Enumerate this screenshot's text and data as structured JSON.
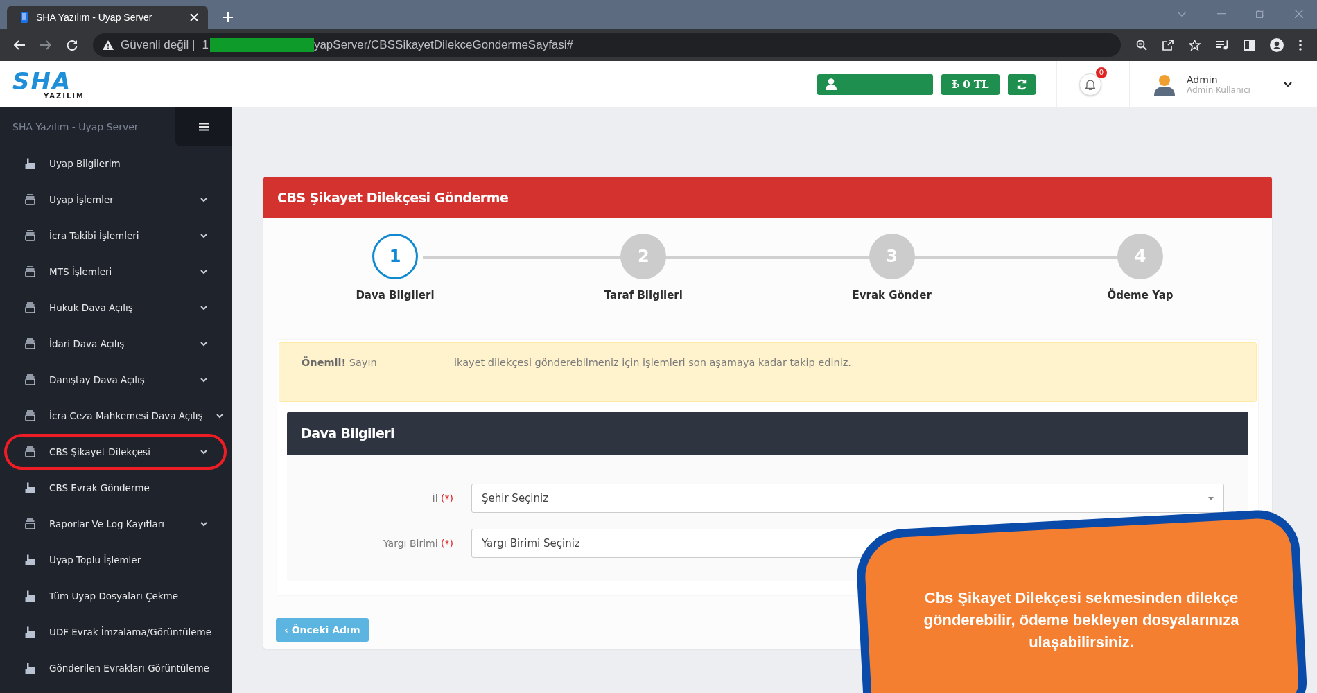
{
  "browser": {
    "tab_title": "SHA Yazılım - Uyap Server",
    "security": "Güvenli değil |",
    "url_start": "1",
    "url": "yapServer/CBSSikayetDilekceGondermeSayfasi#"
  },
  "header": {
    "logo": "SHA",
    "logo_sub": "YAZILIM",
    "balance": "₺ 0 TL",
    "notification_count": "0",
    "user_name": "Admin",
    "user_role": "Admin Kullanıcı"
  },
  "sidebar": {
    "title": "SHA Yazılım - Uyap Server",
    "items": [
      {
        "label": "Uyap Bilgilerim",
        "kind": "link",
        "selected": false
      },
      {
        "label": "Uyap İşlemler",
        "kind": "menu",
        "selected": false
      },
      {
        "label": "İcra Takibi İşlemleri",
        "kind": "menu",
        "selected": false
      },
      {
        "label": "MTS İşlemleri",
        "kind": "menu",
        "selected": false
      },
      {
        "label": "Hukuk Dava Açılış",
        "kind": "menu",
        "selected": false
      },
      {
        "label": "İdari Dava Açılış",
        "kind": "menu",
        "selected": false
      },
      {
        "label": "Danıştay Dava Açılış",
        "kind": "menu",
        "selected": false
      },
      {
        "label": "İcra Ceza Mahkemesi Dava Açılış",
        "kind": "menu",
        "selected": false
      },
      {
        "label": "CBS Şikayet Dilekçesi",
        "kind": "menu",
        "selected": true
      },
      {
        "label": "CBS Evrak Gönderme",
        "kind": "link",
        "selected": false
      },
      {
        "label": "Raporlar Ve Log Kayıtları",
        "kind": "menu",
        "selected": false
      },
      {
        "label": "Uyap Toplu İşlemler",
        "kind": "link",
        "selected": false
      },
      {
        "label": "Tüm Uyap Dosyaları Çekme",
        "kind": "link",
        "selected": false
      },
      {
        "label": "UDF Evrak İmzalama/Görüntüleme",
        "kind": "link",
        "selected": false
      },
      {
        "label": "Gönderilen Evrakları Görüntüleme",
        "kind": "link",
        "selected": false
      }
    ]
  },
  "card": {
    "title": "CBS Şikayet Dilekçesi Gönderme",
    "steps": [
      {
        "number": "1",
        "label": "Dava Bilgileri",
        "selected": true
      },
      {
        "number": "2",
        "label": "Taraf Bilgileri",
        "selected": false
      },
      {
        "number": "3",
        "label": "Evrak Gönder",
        "selected": false
      },
      {
        "number": "4",
        "label": "Ödeme Yap",
        "selected": false
      }
    ],
    "notice": {
      "lead": "**Önemli!** Sayın",
      "text": "ikayet dilekçesi gönderebilmeniz için işlemleri son aşamaya kadar takip ediniz."
    },
    "section_title": "Dava Bilgileri",
    "fields": [
      {
        "label": "İl",
        "required": "(*)",
        "placeholder": "Şehir Seçiniz"
      },
      {
        "label": "Yargı Birimi",
        "required": "(*)",
        "placeholder": "Yargı Birimi Seçiniz"
      }
    ],
    "back_button": "‹ Önceki Adım"
  },
  "callout": {
    "text": "Cbs Şikayet Dilekçesi sekmesinden dilekçe gönderebilir, ödeme bekleyen  dosyalarınıza ulaşabilirsiniz."
  }
}
